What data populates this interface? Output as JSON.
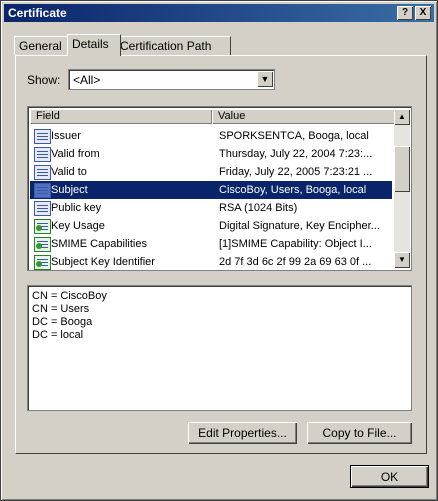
{
  "window": {
    "title": "Certificate",
    "help_button": "?",
    "close_button": "X"
  },
  "tabs": [
    {
      "label": "General"
    },
    {
      "label": "Details"
    },
    {
      "label": "Certification Path"
    }
  ],
  "show": {
    "label": "Show:",
    "selected": "<All>"
  },
  "list": {
    "columns": {
      "field": "Field",
      "value": "Value"
    },
    "rows": [
      {
        "field": "Issuer",
        "value": "SPORKSENTCA, Booga, local",
        "icon": "certificate-field-icon"
      },
      {
        "field": "Valid from",
        "value": "Thursday, July 22, 2004 7:23:...",
        "icon": "certificate-field-icon"
      },
      {
        "field": "Valid to",
        "value": "Friday, July 22, 2005 7:23:21 ...",
        "icon": "certificate-field-icon"
      },
      {
        "field": "Subject",
        "value": "CiscoBoy, Users, Booga, local",
        "icon": "certificate-field-icon"
      },
      {
        "field": "Public key",
        "value": "RSA (1024 Bits)",
        "icon": "certificate-field-icon"
      },
      {
        "field": "Key Usage",
        "value": "Digital Signature, Key Encipher...",
        "icon": "extension-icon"
      },
      {
        "field": "SMIME Capabilities",
        "value": "[1]SMIME Capability: Object I...",
        "icon": "extension-icon"
      },
      {
        "field": "Subject Key Identifier",
        "value": "2d 7f 3d 6c 2f 99 2a 69 63 0f ...",
        "icon": "extension-icon"
      }
    ]
  },
  "detail_lines": [
    "CN = CiscoBoy",
    "CN = Users",
    "DC = Booga",
    "DC = local"
  ],
  "buttons": {
    "edit_properties": "Edit Properties...",
    "copy_to_file": "Copy to File...",
    "ok": "OK"
  },
  "colors": {
    "selection": "#0a246a",
    "titlebar": "#0a246a",
    "face": "#d4d0c8"
  }
}
